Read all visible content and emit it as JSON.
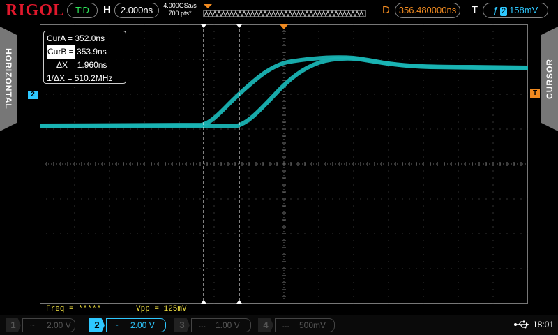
{
  "brand": "RIGOL",
  "top": {
    "run_status": "T'D",
    "h_label": "H",
    "timebase": "2.000ns",
    "sample_rate": "4.000GSa/s",
    "mem_depth": "700 pts*",
    "d_label": "D",
    "delay": "356.480000ns",
    "t_label": "T",
    "trigger_edge_icon": "rising-edge-icon",
    "trigger_source": "2",
    "trigger_level": "158mV"
  },
  "tabs": {
    "left": "HORIZONTAL",
    "right": "CURSOR"
  },
  "cursor_panel": {
    "rows": [
      {
        "label": "CurA =",
        "value": "352.0ns",
        "selected": false
      },
      {
        "label": "CurB =",
        "value": "353.9ns",
        "selected": true
      },
      {
        "label": "ΔX =",
        "value": "1.960ns",
        "selected": false
      },
      {
        "label": "1/ΔX =",
        "value": "510.2MHz",
        "selected": false
      }
    ]
  },
  "markers": {
    "channel": "2",
    "trigger": "T"
  },
  "measurements": {
    "freq": "Freq = *****",
    "vpp": "Vpp = 125mV"
  },
  "channels": [
    {
      "num": "1",
      "coupling": "~",
      "scale": "2.00 V",
      "active": false
    },
    {
      "num": "2",
      "coupling": "~",
      "scale": "2.00 V",
      "active": true
    },
    {
      "num": "3",
      "coupling": "⎓",
      "scale": "1.00 V",
      "active": false
    },
    {
      "num": "4",
      "coupling": "⎓",
      "scale": "500mV",
      "active": false
    }
  ],
  "clock": "18:01",
  "colors": {
    "trace": "#19b3b3",
    "channel2": "#2ec8ff",
    "trigger": "#f08a20",
    "brand": "#e0182c",
    "measure": "#f0e040"
  }
}
